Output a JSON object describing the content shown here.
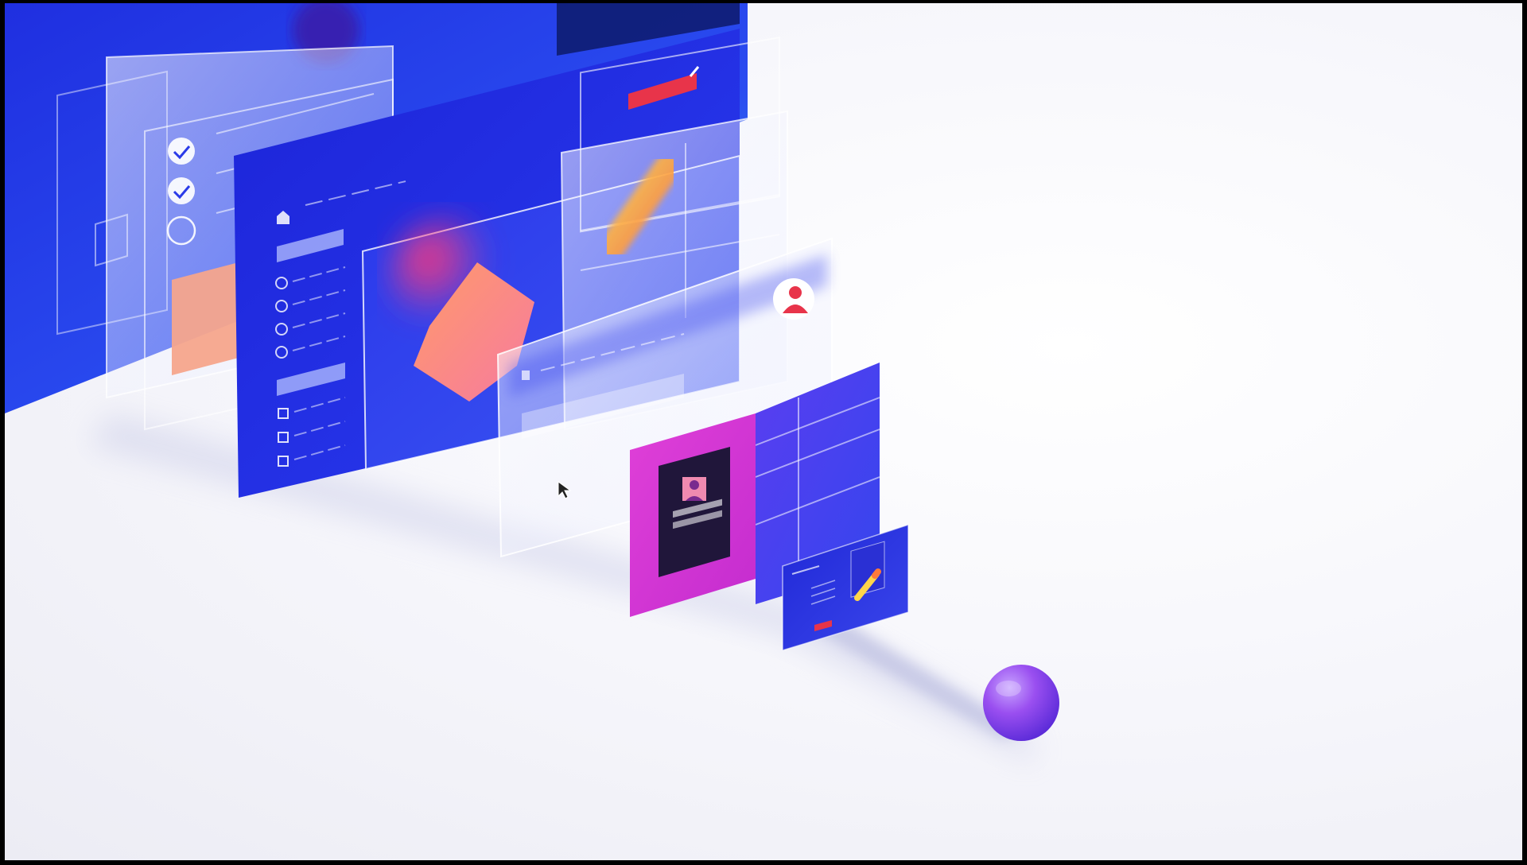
{
  "scene": {
    "description_elements": [
      "large-back-panel",
      "checklist-glass-panel",
      "sidebar-panel",
      "hexagon-panel",
      "striped-glass-panel",
      "profile-glass-panel",
      "grid-panel",
      "profile-card",
      "editor-card",
      "sphere"
    ],
    "colors": {
      "primary_blue": "#2233e6",
      "deep_blue": "#1a22c8",
      "magenta": "#d03ad8",
      "peach": "#f6a58c",
      "sphere_purple": "#8a3fe6",
      "red_accent": "#e8344a",
      "yellow_accent": "#f4d23c",
      "background": "#f4f4f9"
    },
    "icons": [
      "check-icon",
      "check-icon",
      "empty-circle-icon",
      "home-icon",
      "radio-icon",
      "checkbox-icon",
      "user-avatar-icon",
      "pencil-icon",
      "mouse-cursor-icon"
    ]
  }
}
